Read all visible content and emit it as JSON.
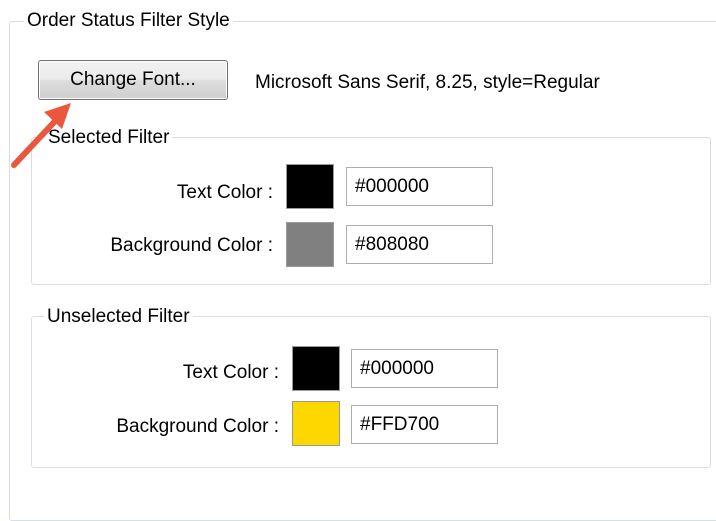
{
  "order_status_filter_style": {
    "title": "Order Status Filter Style",
    "change_font_label": "Change Font...",
    "font_description": "Microsoft Sans Serif, 8.25, style=Regular"
  },
  "selected_filter": {
    "title": "Selected Filter",
    "text_color_label": "Text Color :",
    "text_color_value": "#000000",
    "text_color_swatch": "#000000",
    "background_color_label": "Background Color :",
    "background_color_value": "#808080",
    "background_color_swatch": "#808080"
  },
  "unselected_filter": {
    "title": "Unselected Filter",
    "text_color_label": "Text Color :",
    "text_color_value": "#000000",
    "text_color_swatch": "#000000",
    "background_color_label": "Background Color :",
    "background_color_value": "#FFD700",
    "background_color_swatch": "#FFD700"
  },
  "annotation": {
    "arrow_color": "#e8573e",
    "arrow_target": "change-font-button"
  }
}
